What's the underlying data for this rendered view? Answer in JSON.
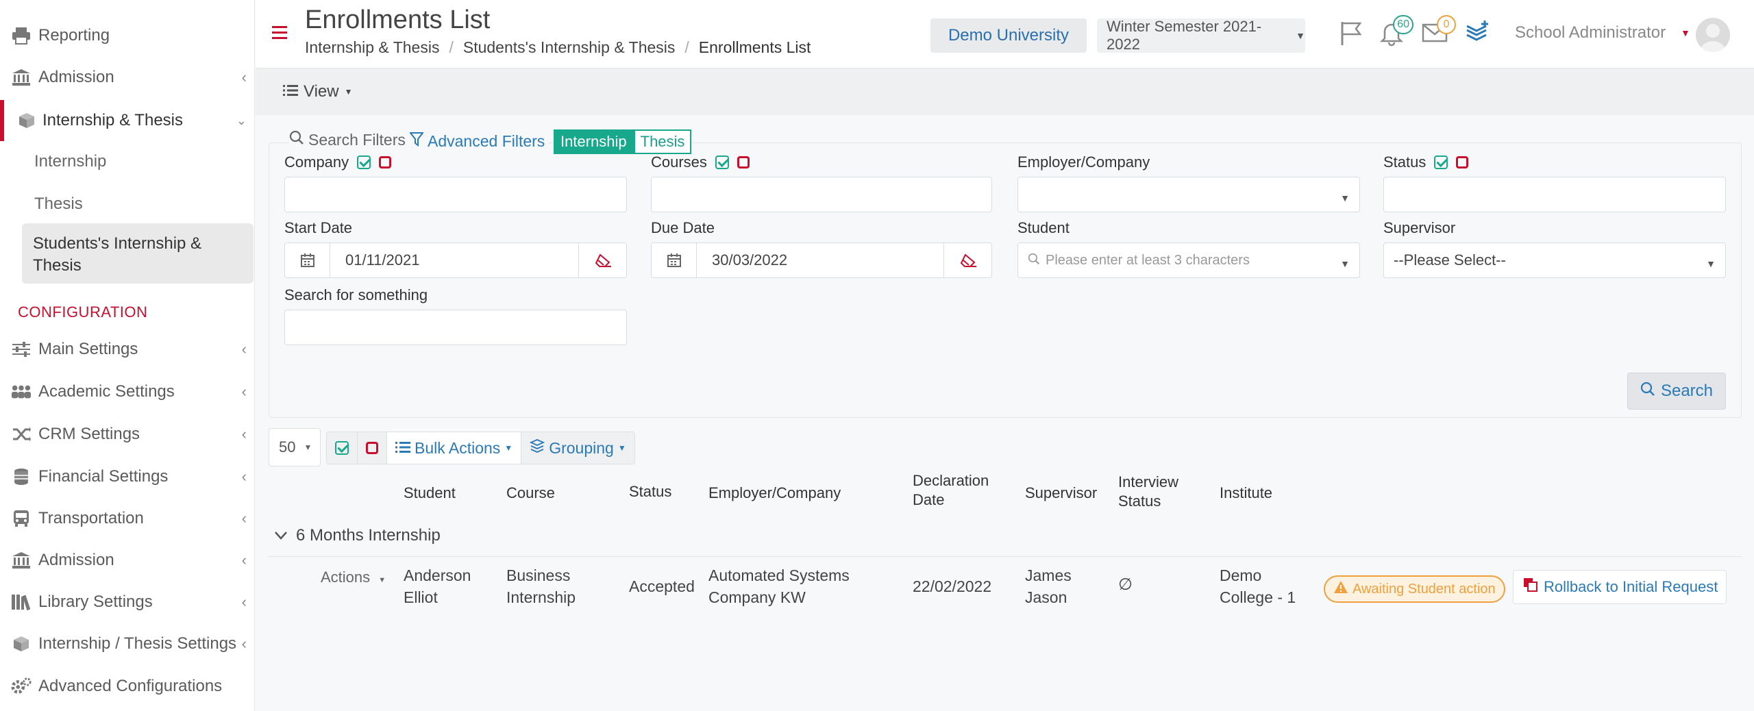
{
  "sidebar": {
    "items": [
      {
        "label": "Reporting",
        "icon": "printer-icon"
      },
      {
        "label": "Admission",
        "icon": "bank-icon"
      },
      {
        "label": "Internship & Thesis",
        "icon": "box-icon"
      }
    ],
    "sub_items": [
      "Internship",
      "Thesis"
    ],
    "active_sub": "Students's Internship & Thesis",
    "config_heading": "CONFIGURATION",
    "config_items": [
      {
        "label": "Main Settings",
        "icon": "sliders-icon"
      },
      {
        "label": "Academic Settings",
        "icon": "users-icon"
      },
      {
        "label": "CRM Settings",
        "icon": "shuffle-icon"
      },
      {
        "label": "Financial Settings",
        "icon": "coins-icon"
      },
      {
        "label": "Transportation",
        "icon": "bus-icon"
      },
      {
        "label": "Admission",
        "icon": "bank-icon"
      },
      {
        "label": "Library Settings",
        "icon": "books-icon"
      },
      {
        "label": "Internship / Thesis Settings",
        "icon": "box-icon"
      },
      {
        "label": "Advanced Configurations",
        "icon": "gears-icon"
      }
    ]
  },
  "header": {
    "title": "Enrollments List",
    "breadcrumb": [
      "Internship & Thesis",
      "Students's Internship & Thesis",
      "Enrollments List"
    ],
    "university": "Demo University",
    "semester": "Winter Semester 2021-2022",
    "notifications_count": "60",
    "messages_count": "0",
    "user": "School Administrator"
  },
  "toolbar": {
    "view_label": "View"
  },
  "filters": {
    "search_filters_label": "Search Filters",
    "advanced_filters_label": "Advanced Filters",
    "toggle": {
      "on": "Internship",
      "off": "Thesis"
    },
    "company_label": "Company",
    "courses_label": "Courses",
    "employer_label": "Employer/Company",
    "status_label": "Status",
    "start_date_label": "Start Date",
    "start_date_value": "01/11/2021",
    "due_date_label": "Due Date",
    "due_date_value": "30/03/2022",
    "student_label": "Student",
    "student_placeholder": "Please enter at least 3 characters",
    "supervisor_label": "Supervisor",
    "supervisor_value": "--Please Select--",
    "search_something_label": "Search for something",
    "search_button": "Search"
  },
  "table": {
    "page_size": "50",
    "bulk_actions": "Bulk Actions",
    "grouping": "Grouping",
    "headers": {
      "student": "Student",
      "course": "Course",
      "status": "Status",
      "employer": "Employer/Company",
      "declaration_date": "Declaration Date",
      "supervisor": "Supervisor",
      "interview_status": "Interview Status",
      "institute": "Institute"
    },
    "group_label": "6 Months Internship",
    "rows": [
      {
        "actions": "Actions",
        "student": "Anderson Elliot",
        "course": "Business Internship",
        "status": "Accepted",
        "employer": "Automated Systems Company KW",
        "declaration_date": "22/02/2022",
        "supervisor": "James Jason",
        "interview_status": "∅",
        "institute": "Demo College - 1",
        "state_badge": "Awaiting Student action",
        "rollback": "Rollback to Initial Request"
      }
    ]
  }
}
